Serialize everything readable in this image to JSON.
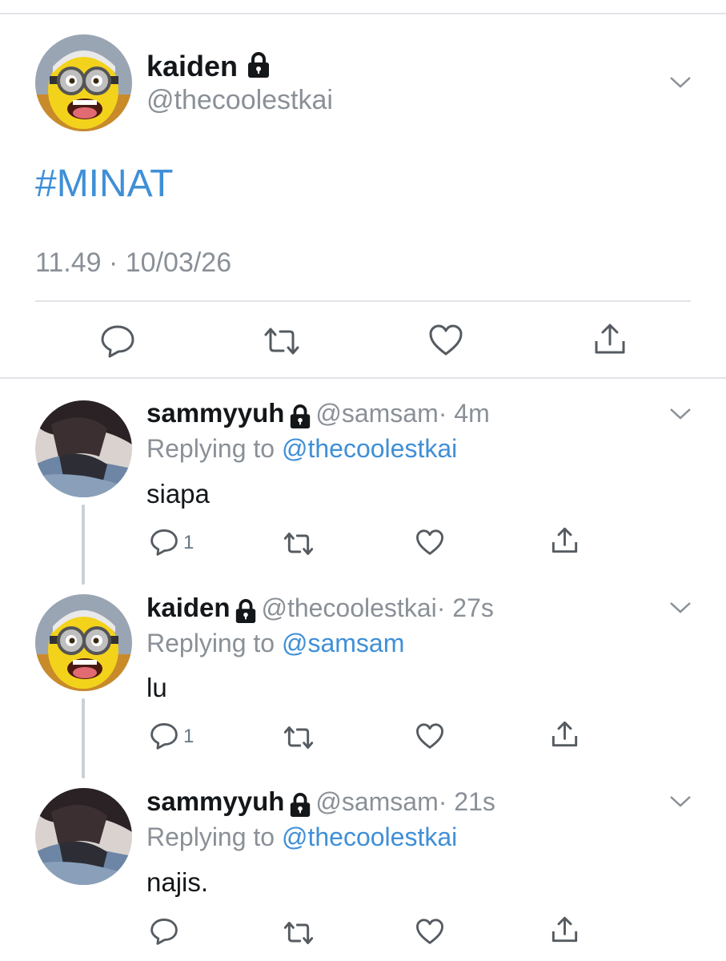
{
  "main_tweet": {
    "name": "kaiden",
    "handle": "@thecoolestkai",
    "text": "#MINAT",
    "timestamp": "11.49 · 10/03/26"
  },
  "replies": [
    {
      "name": "sammyyuh",
      "handle": "@samsam",
      "time": "· 4m",
      "replying_label": "Replying to",
      "replying_to": "@thecoolestkai",
      "text": "siapa",
      "reply_count": "1"
    },
    {
      "name": "kaiden",
      "handle": "@thecoolestkai",
      "time": "· 27s",
      "replying_label": "Replying to",
      "replying_to": "@samsam",
      "text": "lu",
      "reply_count": "1"
    },
    {
      "name": "sammyyuh",
      "handle": "@samsam",
      "time": "· 21s",
      "replying_label": "Replying to",
      "replying_to": "@thecoolestkai",
      "text": "najis.",
      "reply_count": ""
    }
  ],
  "colors": {
    "link": "#3f8fd7",
    "muted": "#8a9097",
    "icon": "#555b61",
    "divider": "#e1e4e8"
  },
  "icons": [
    "lock-icon",
    "chevron-down-icon",
    "reply-icon",
    "retweet-icon",
    "like-icon",
    "share-icon"
  ]
}
